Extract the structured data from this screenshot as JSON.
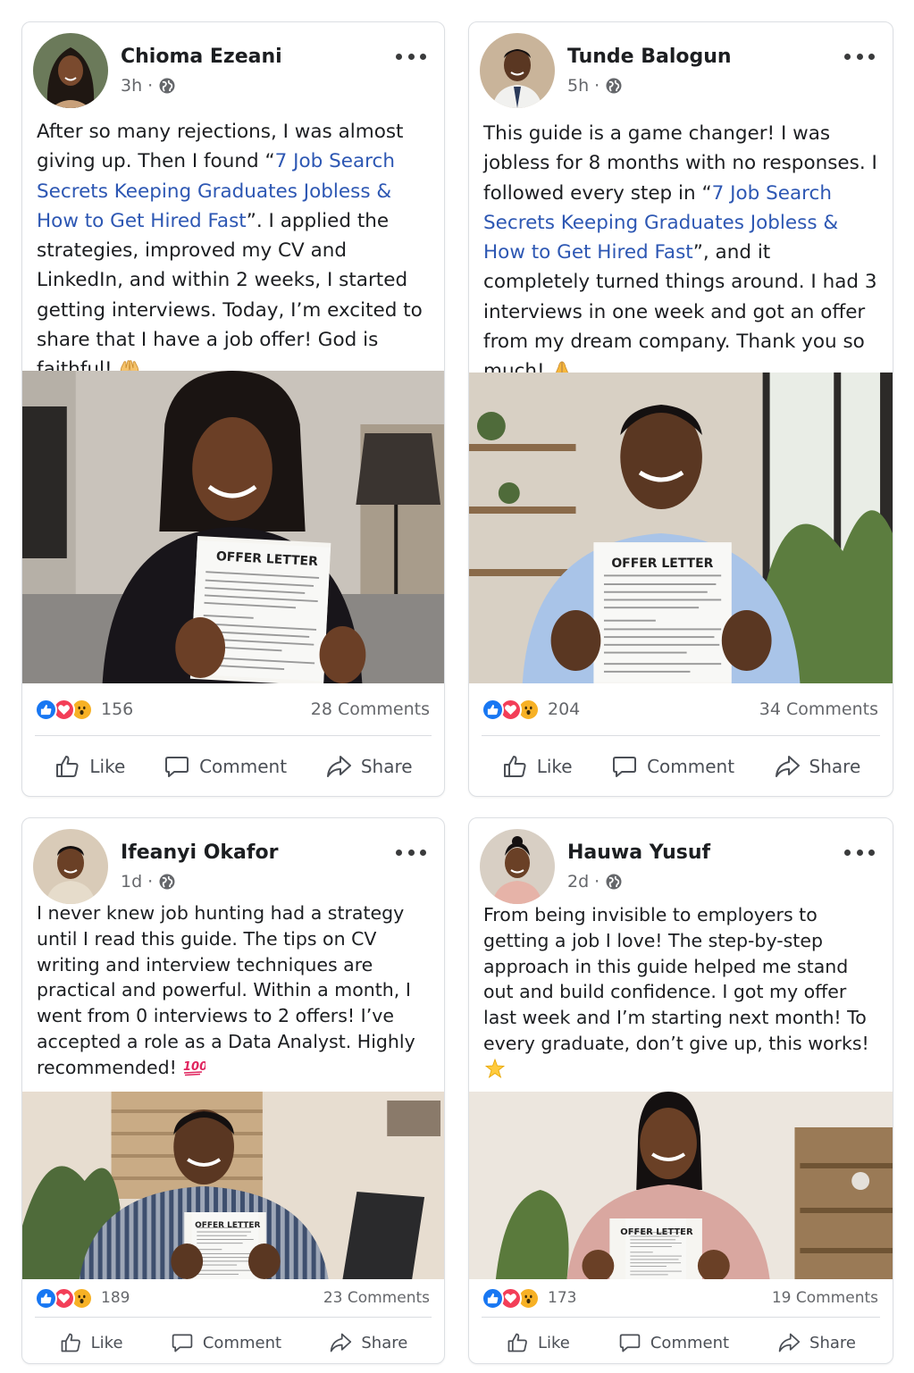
{
  "posts": [
    {
      "author": "Chioma Ezeani",
      "time": "3h",
      "time_sep": "·",
      "text_a": "After so many rejections, I was almost giving up. Then I found “",
      "link": "7 Job Search Secrets Keeping Graduates Jobless & How to Get Hired Fast",
      "text_b": "”. I applied the strategies, improved my CV and LinkedIn, and within 2 weeks, I started getting interviews. Today, I’m excited to share that I have a job offer! God is faithful!",
      "emoji": "raising-hands-icon",
      "photo_label": "OFFER LETTER",
      "reaction_count": "156",
      "comments": "28 Comments"
    },
    {
      "author": "Tunde Balogun",
      "time": "5h",
      "time_sep": "·",
      "text_a": "This guide is a game changer! I was jobless for 8 months with no responses. I followed every step in “",
      "link": "7 Job Search Secrets Keeping Graduates Jobless & How to Get Hired Fast",
      "text_b": "”, and it completely turned things around. I had 3 interviews in one week and got an offer from my dream company. Thank you so much!",
      "emoji": "folded-hands-icon",
      "photo_label": "OFFER LETTER",
      "reaction_count": "204",
      "comments": "34 Comments"
    },
    {
      "author": "Ifeanyi Okafor",
      "time": "1d",
      "time_sep": "·",
      "text_a": "I never knew job hunting had a strategy until I read this guide. The tips on CV writing and interview techniques are practical and powerful. Within a month, I went from 0 interviews to 2 offers! I’ve accepted a role as a Data Analyst. Highly recommended!",
      "link": "",
      "text_b": "",
      "emoji": "hundred-points-icon",
      "photo_label": "OFFER LETTER",
      "reaction_count": "189",
      "comments": "23 Comments"
    },
    {
      "author": "Hauwa Yusuf",
      "time": "2d",
      "time_sep": "·",
      "text_a": "From being invisible to employers to getting a job I love! The step-by-step approach in this guide helped me stand out and build confidence. I got my offer last week and I’m starting next month! To every graduate, don’t give up, this works!",
      "link": "",
      "text_b": "",
      "emoji": "glowing-star-icon",
      "photo_label": "OFFER LETTER",
      "reaction_count": "173",
      "comments": "19 Comments"
    }
  ],
  "actions": {
    "like": "Like",
    "comment": "Comment",
    "share": "Share"
  },
  "colors": {
    "link": "#2d57b3",
    "like_blue": "#1877f2",
    "love_red": "#f33e58",
    "wow_yellow": "#f7b125",
    "muted": "#65676b"
  },
  "icons": [
    "more-options-icon",
    "globe-icon",
    "like-reaction-icon",
    "love-reaction-icon",
    "wow-reaction-icon",
    "thumbs-up-icon",
    "comment-bubble-icon",
    "share-arrow-icon"
  ]
}
